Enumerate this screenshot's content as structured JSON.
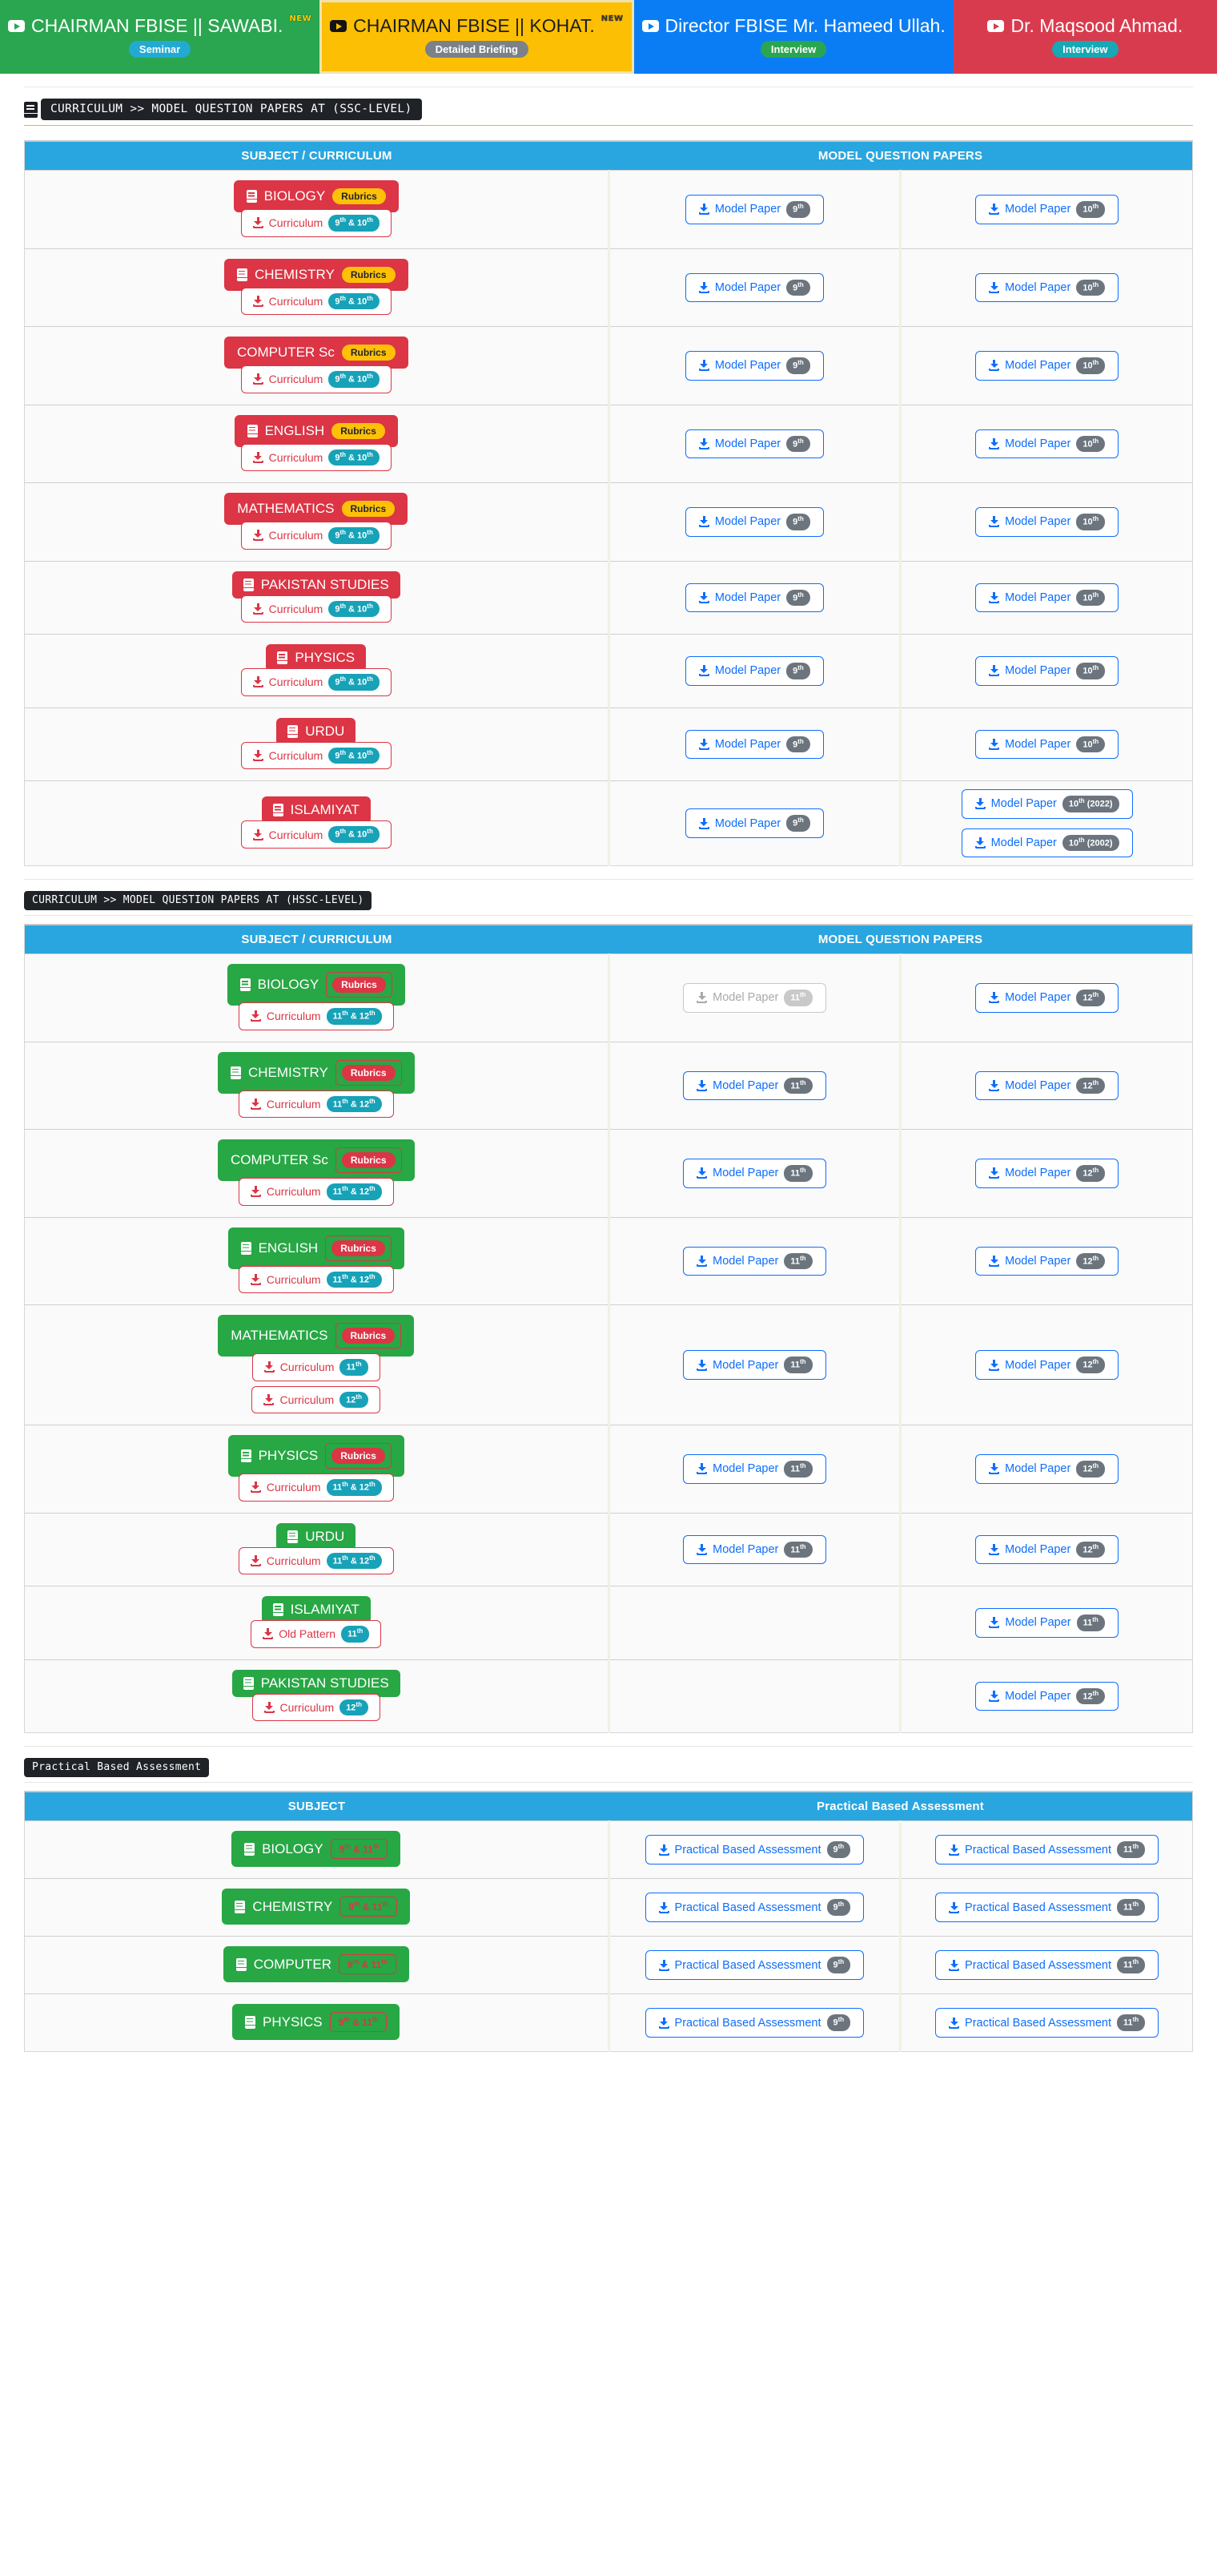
{
  "banner": {
    "items": [
      {
        "title": "CHAIRMAN FBISE || SAWABI.",
        "new": "NEW",
        "badge": "Seminar",
        "color": "green"
      },
      {
        "title": "CHAIRMAN FBISE || KOHAT.",
        "new": "NEW",
        "badge": "Detailed Briefing",
        "color": "yellow"
      },
      {
        "title": "Director FBISE Mr. Hameed Ullah.",
        "new": "",
        "badge": "Interview",
        "color": "blue"
      },
      {
        "title": "Dr. Maqsood Ahmad.",
        "new": "",
        "badge": "Interview",
        "color": "red"
      }
    ]
  },
  "ssc": {
    "section_title": "CURRICULUM >> MODEL QUESTION PAPERS AT (SSC-LEVEL)",
    "headers": [
      "SUBJECT / CURRICULUM",
      "MODEL QUESTION PAPERS",
      ""
    ],
    "rows": [
      {
        "subject": "BIOLOGY",
        "rubrics": "Rubrics",
        "show_icon": true,
        "curriculum": [
          {
            "label": "Curriculum",
            "badge": "9th & 10th"
          }
        ],
        "col2": [
          {
            "label": "Model Paper",
            "badge": "9th"
          }
        ],
        "col3": [
          {
            "label": "Model Paper",
            "badge": "10th"
          }
        ]
      },
      {
        "subject": "CHEMISTRY",
        "rubrics": "Rubrics",
        "show_icon": true,
        "curriculum": [
          {
            "label": "Curriculum",
            "badge": "9th & 10th"
          }
        ],
        "col2": [
          {
            "label": "Model Paper",
            "badge": "9th"
          }
        ],
        "col3": [
          {
            "label": "Model Paper",
            "badge": "10th"
          }
        ]
      },
      {
        "subject": "COMPUTER Sc",
        "rubrics": "Rubrics",
        "show_icon": false,
        "curriculum": [
          {
            "label": "Curriculum",
            "badge": "9th & 10th"
          }
        ],
        "col2": [
          {
            "label": "Model Paper",
            "badge": "9th"
          }
        ],
        "col3": [
          {
            "label": "Model Paper",
            "badge": "10th"
          }
        ]
      },
      {
        "subject": "ENGLISH",
        "rubrics": "Rubrics",
        "show_icon": true,
        "curriculum": [
          {
            "label": "Curriculum",
            "badge": "9th & 10th"
          }
        ],
        "col2": [
          {
            "label": "Model Paper",
            "badge": "9th"
          }
        ],
        "col3": [
          {
            "label": "Model Paper",
            "badge": "10th"
          }
        ]
      },
      {
        "subject": "MATHEMATICS",
        "rubrics": "Rubrics",
        "show_icon": false,
        "curriculum": [
          {
            "label": "Curriculum",
            "badge": "9th & 10th"
          }
        ],
        "col2": [
          {
            "label": "Model Paper",
            "badge": "9th"
          }
        ],
        "col3": [
          {
            "label": "Model Paper",
            "badge": "10th"
          }
        ]
      },
      {
        "subject": "PAKISTAN STUDIES",
        "rubrics": "",
        "show_icon": true,
        "curriculum": [
          {
            "label": "Curriculum",
            "badge": "9th & 10th"
          }
        ],
        "col2": [
          {
            "label": "Model Paper",
            "badge": "9th"
          }
        ],
        "col3": [
          {
            "label": "Model Paper",
            "badge": "10th"
          }
        ]
      },
      {
        "subject": "PHYSICS",
        "rubrics": "",
        "show_icon": true,
        "curriculum": [
          {
            "label": "Curriculum",
            "badge": "9th & 10th"
          }
        ],
        "col2": [
          {
            "label": "Model Paper",
            "badge": "9th"
          }
        ],
        "col3": [
          {
            "label": "Model Paper",
            "badge": "10th"
          }
        ]
      },
      {
        "subject": "URDU",
        "rubrics": "",
        "show_icon": true,
        "curriculum": [
          {
            "label": "Curriculum",
            "badge": "9th & 10th"
          }
        ],
        "col2": [
          {
            "label": "Model Paper",
            "badge": "9th"
          }
        ],
        "col3": [
          {
            "label": "Model Paper",
            "badge": "10th"
          }
        ]
      },
      {
        "subject": "ISLAMIYAT",
        "rubrics": "",
        "show_icon": true,
        "curriculum": [
          {
            "label": "Curriculum",
            "badge": "9th & 10th"
          }
        ],
        "col2": [
          {
            "label": "Model Paper",
            "badge": "9th"
          }
        ],
        "col3": [
          {
            "label": "Model Paper",
            "badge": "10th (2022)"
          },
          {
            "label": "Model Paper",
            "badge": "10th (2002)"
          }
        ]
      }
    ]
  },
  "hssc": {
    "section_title": "CURRICULUM >> MODEL QUESTION PAPERS AT (HSSC-LEVEL)",
    "headers": [
      "SUBJECT / CURRICULUM",
      "MODEL QUESTION PAPERS",
      ""
    ],
    "rows": [
      {
        "subject": "BIOLOGY",
        "rubrics": "Rubrics",
        "show_icon": true,
        "curriculum": [
          {
            "label": "Curriculum",
            "badge": "11th & 12th"
          }
        ],
        "col2": [
          {
            "label": "Model Paper",
            "badge": "11th",
            "disabled": true
          }
        ],
        "col3": [
          {
            "label": "Model Paper",
            "badge": "12th"
          }
        ]
      },
      {
        "subject": "CHEMISTRY",
        "rubrics": "Rubrics",
        "show_icon": true,
        "curriculum": [
          {
            "label": "Curriculum",
            "badge": "11th & 12th"
          }
        ],
        "col2": [
          {
            "label": "Model Paper",
            "badge": "11th"
          }
        ],
        "col3": [
          {
            "label": "Model Paper",
            "badge": "12th"
          }
        ]
      },
      {
        "subject": "COMPUTER Sc",
        "rubrics": "Rubrics",
        "show_icon": false,
        "curriculum": [
          {
            "label": "Curriculum",
            "badge": "11th & 12th"
          }
        ],
        "col2": [
          {
            "label": "Model Paper",
            "badge": "11th"
          }
        ],
        "col3": [
          {
            "label": "Model Paper",
            "badge": "12th"
          }
        ]
      },
      {
        "subject": "ENGLISH",
        "rubrics": "Rubrics",
        "show_icon": true,
        "curriculum": [
          {
            "label": "Curriculum",
            "badge": "11th & 12th"
          }
        ],
        "col2": [
          {
            "label": "Model Paper",
            "badge": "11th"
          }
        ],
        "col3": [
          {
            "label": "Model Paper",
            "badge": "12th"
          }
        ]
      },
      {
        "subject": "MATHEMATICS",
        "rubrics": "Rubrics",
        "show_icon": false,
        "curriculum": [
          {
            "label": "Curriculum",
            "badge": "11th"
          },
          {
            "label": "Curriculum",
            "badge": "12th"
          }
        ],
        "col2": [
          {
            "label": "Model Paper",
            "badge": "11th"
          }
        ],
        "col3": [
          {
            "label": "Model Paper",
            "badge": "12th"
          }
        ]
      },
      {
        "subject": "PHYSICS",
        "rubrics": "Rubrics",
        "show_icon": true,
        "curriculum": [
          {
            "label": "Curriculum",
            "badge": "11th & 12th"
          }
        ],
        "col2": [
          {
            "label": "Model Paper",
            "badge": "11th"
          }
        ],
        "col3": [
          {
            "label": "Model Paper",
            "badge": "12th"
          }
        ]
      },
      {
        "subject": "URDU",
        "rubrics": "",
        "show_icon": true,
        "curriculum": [
          {
            "label": "Curriculum",
            "badge": "11th & 12th"
          }
        ],
        "col2": [
          {
            "label": "Model Paper",
            "badge": "11th"
          }
        ],
        "col3": [
          {
            "label": "Model Paper",
            "badge": "12th"
          }
        ]
      },
      {
        "subject": "ISLAMIYAT",
        "rubrics": "",
        "show_icon": true,
        "curriculum": [
          {
            "label": "Old Pattern",
            "badge": "11th"
          }
        ],
        "col2": [],
        "col3": [
          {
            "label": "Model Paper",
            "badge": "11th"
          }
        ]
      },
      {
        "subject": "PAKISTAN STUDIES",
        "rubrics": "",
        "show_icon": true,
        "curriculum": [
          {
            "label": "Curriculum",
            "badge": "12th"
          }
        ],
        "col2": [],
        "col3": [
          {
            "label": "Model Paper",
            "badge": "12th"
          }
        ]
      }
    ]
  },
  "practical": {
    "section_title": "Practical Based Assessment",
    "headers": [
      "SUBJECT",
      "Practical Based Assessment",
      ""
    ],
    "rows": [
      {
        "subject": "BIOLOGY",
        "grades": "9th & 11th",
        "show_icon": true,
        "col2": [
          {
            "label": "Practical Based Assessment",
            "badge": "9th"
          }
        ],
        "col3": [
          {
            "label": "Practical Based Assessment",
            "badge": "11th"
          }
        ]
      },
      {
        "subject": "CHEMISTRY",
        "grades": "9th & 11th",
        "show_icon": true,
        "col2": [
          {
            "label": "Practical Based Assessment",
            "badge": "9th"
          }
        ],
        "col3": [
          {
            "label": "Practical Based Assessment",
            "badge": "11th"
          }
        ]
      },
      {
        "subject": "COMPUTER",
        "grades": "9th & 11th",
        "show_icon": true,
        "col2": [
          {
            "label": "Practical Based Assessment",
            "badge": "9th"
          }
        ],
        "col3": [
          {
            "label": "Practical Based Assessment",
            "badge": "11th"
          }
        ]
      },
      {
        "subject": "PHYSICS",
        "grades": "9th & 11th",
        "show_icon": true,
        "col2": [
          {
            "label": "Practical Based Assessment",
            "badge": "9th"
          }
        ],
        "col3": [
          {
            "label": "Practical Based Assessment",
            "badge": "11th"
          }
        ]
      }
    ]
  }
}
